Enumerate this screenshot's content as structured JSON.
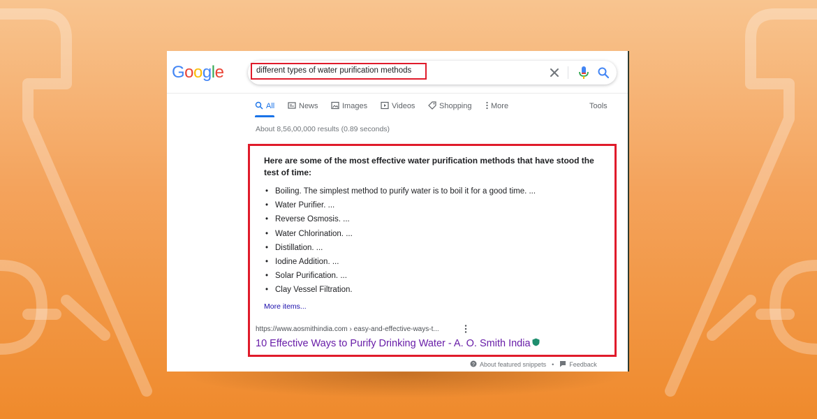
{
  "colors": {
    "accent": "#1a73e8",
    "highlight_border": "#e01b2b",
    "visited_link": "#681da8",
    "link": "#1a0dab"
  },
  "logo": {
    "letters": [
      "G",
      "o",
      "o",
      "g",
      "l",
      "e"
    ],
    "colors": [
      "#4285f4",
      "#ea4335",
      "#fbbc05",
      "#4285f4",
      "#34a853",
      "#ea4335"
    ]
  },
  "search": {
    "query": "different types of water purification methods",
    "icons": [
      "close-icon",
      "mic-icon",
      "search-icon"
    ]
  },
  "tabs": [
    {
      "label": "All",
      "icon": "search-icon"
    },
    {
      "label": "News",
      "icon": "news-icon"
    },
    {
      "label": "Images",
      "icon": "image-icon"
    },
    {
      "label": "Videos",
      "icon": "video-icon"
    },
    {
      "label": "Shopping",
      "icon": "tag-icon"
    },
    {
      "label": "More",
      "icon": "dots-vertical-icon"
    }
  ],
  "tools_label": "Tools",
  "results_stats": "About 8,56,00,000 results (0.89 seconds)",
  "snippet": {
    "heading": "Here are some of the most effective water purification methods that have stood the test of time:",
    "items": [
      "Boiling. The simplest method to purify water is to boil it for a good time. ...",
      "Water Purifier. ...",
      "Reverse Osmosis. ...",
      "Water Chlorination. ...",
      "Distillation. ...",
      "Iodine Addition. ...",
      "Solar Purification. ...",
      "Clay Vessel Filtration."
    ],
    "more_items": "More items...",
    "source_url": "https://www.aosmithindia.com › easy-and-effective-ways-t...",
    "result_title": "10 Effective Ways to Purify Drinking Water - A. O. Smith India"
  },
  "footer": {
    "about": "About featured snippets",
    "separator": "•",
    "feedback": "Feedback"
  }
}
